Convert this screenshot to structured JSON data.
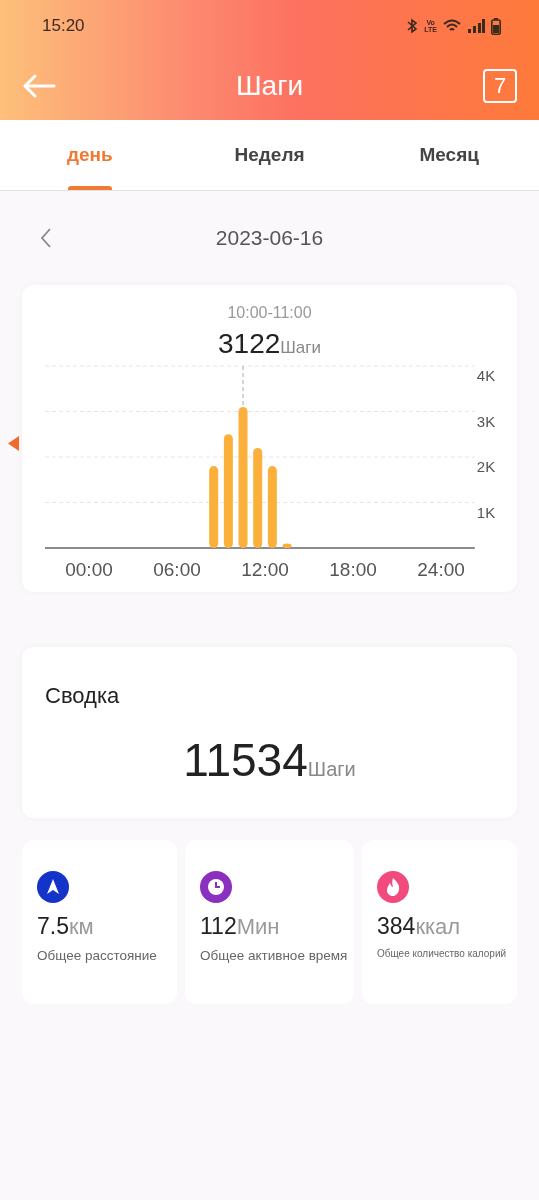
{
  "status_bar": {
    "time": "15:20",
    "volte": [
      "Vo",
      "LTE"
    ]
  },
  "header": {
    "title": "Шаги",
    "calendar_day": "7"
  },
  "tabs": [
    {
      "label": "день",
      "selected": true
    },
    {
      "label": "Неделя",
      "selected": false
    },
    {
      "label": "Месяц",
      "selected": false
    }
  ],
  "date": "2023-06-16",
  "chart": {
    "range": "10:00-11:00",
    "value": "3122",
    "unit": "Шаги",
    "chart_data": {
      "type": "bar",
      "x": [
        8.5,
        9.5,
        10.5,
        11.5,
        12.5,
        13.5
      ],
      "values": [
        1800,
        2500,
        3100,
        2200,
        1800,
        100
      ],
      "xlim": [
        -3,
        26.3
      ],
      "ylim": [
        0,
        4000
      ],
      "grid": true,
      "xticks": [
        {
          "value": 0,
          "label": "00:00"
        },
        {
          "value": 6,
          "label": "06:00"
        },
        {
          "value": 12,
          "label": "12:00"
        },
        {
          "value": 18,
          "label": "18:00"
        },
        {
          "value": 24,
          "label": "24:00"
        }
      ],
      "yticks": [
        {
          "value": 1000,
          "label": "1K"
        },
        {
          "value": 2000,
          "label": "2K"
        },
        {
          "value": 3000,
          "label": "3K"
        },
        {
          "value": 4000,
          "label": "4K"
        }
      ],
      "ref_lines": [
        {
          "axis": "x",
          "value": 10.5
        }
      ]
    }
  },
  "summary": {
    "title": "Сводка",
    "value": "11534",
    "unit": "Шаги"
  },
  "stats": [
    {
      "kind": "distance",
      "value": "7.5",
      "unit": "км",
      "label": "Общее расстояние",
      "color": "#1433c8"
    },
    {
      "kind": "time",
      "value": "112",
      "unit": "Мин",
      "label": "Общее активное время",
      "color": "#8a2fc0"
    },
    {
      "kind": "calories",
      "value": "384",
      "unit": "ккал",
      "label": "Общее количество калорий",
      "color": "#f24a7c"
    }
  ]
}
